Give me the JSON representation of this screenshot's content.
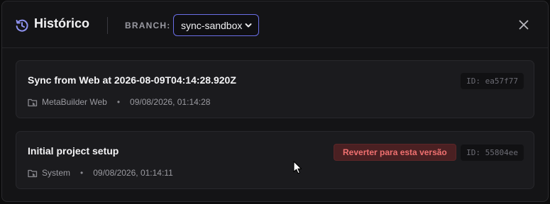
{
  "header": {
    "title": "Histórico",
    "branch_label": "BRANCH:",
    "branch_selected": "sync-sandbox"
  },
  "commits": [
    {
      "message": "Sync from Web at 2026-08-09T04:14:28.920Z",
      "source": "MetaBuilder Web",
      "timestamp": "09/08/2026, 01:14:28",
      "id": "ID: ea57f77"
    },
    {
      "message": "Initial project setup",
      "source": "System",
      "timestamp": "09/08/2026, 01:14:11",
      "id": "ID: 55804ee",
      "revert_label": "Reverter para esta versão"
    }
  ],
  "meta_separator": "•",
  "colors": {
    "accent": "#6a6ee6",
    "danger_text": "#f07070",
    "danger_bg": "#4a2022"
  }
}
